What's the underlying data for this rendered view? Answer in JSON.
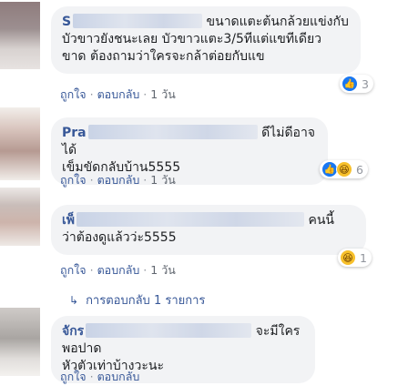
{
  "comments": [
    {
      "name": "S",
      "text_line1": "ขนาดแตะต้นกล้วยแข่งกับ",
      "text_line2": "บัวขาวยังชนะเลย บัวขาวแตะ3/5ทีแต่แขทีเดียว",
      "text_line3": "ขาด ต้องถามว่าใครจะกล้าต่อยกับแข",
      "like_label": "ถูกใจ",
      "reply_label": "ตอบกลับ",
      "time": "1 วัน",
      "reaction_icon": "like-icon",
      "reaction_count": "3"
    },
    {
      "name": "Pra",
      "text_line1": "ดีไม่ดีอาจได้",
      "text_line2": "เข็มขัดกลับบ้าน5555",
      "like_label": "ถูกใจ",
      "reply_label": "ตอบกลับ",
      "time": "1 วัน",
      "reaction_icons": [
        "like-icon",
        "haha-icon"
      ],
      "reaction_count": "6"
    },
    {
      "name": "เพ็",
      "text_line1": "คนนี้",
      "text_line2": "ว่าต้องดูแล้วว่ะ5555",
      "like_label": "ถูกใจ",
      "reply_label": "ตอบกลับ",
      "time": "1 วัน",
      "reaction_icon": "haha-icon",
      "reaction_count": "1"
    },
    {
      "name": "จักร",
      "text_line1": "จะมีใครพอปาด",
      "text_line2": "หัวตัวเท่าบ้างวะนะ",
      "like_label": "ถูกใจ",
      "reply_label": "ตอบกลับ"
    }
  ],
  "replies_link": "การตอบกลับ 1 รายการ",
  "colors": {
    "link": "#385898",
    "bubble": "#f2f3f5",
    "meta": "#616770",
    "like": "#1877f2",
    "haha": "#f7c02b"
  }
}
